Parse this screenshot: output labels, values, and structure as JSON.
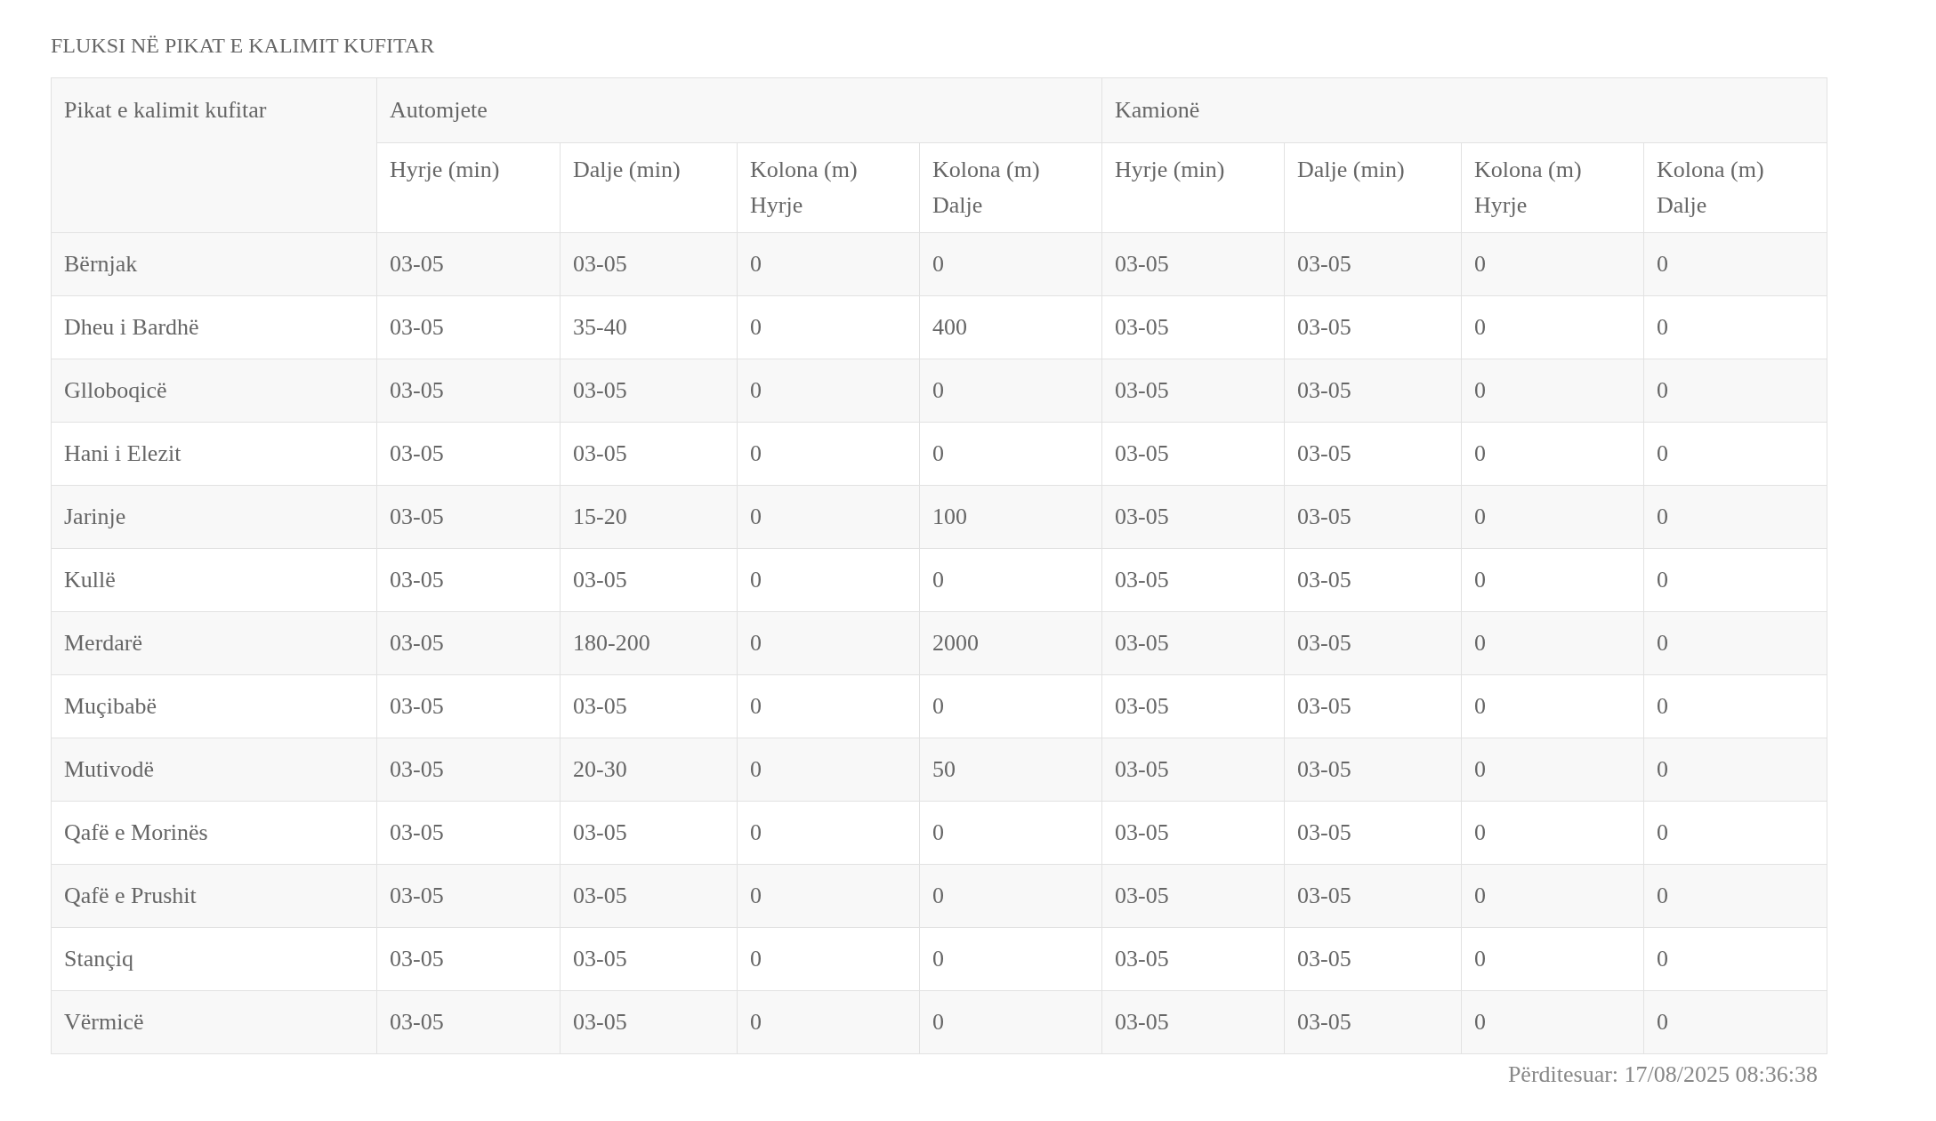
{
  "title": "FLUKSI NË PIKAT E KALIMIT KUFITAR",
  "table": {
    "first_column": "Pikat e kalimit kufitar",
    "groups": [
      {
        "label": "Automjete",
        "columns": [
          "Hyrje (min)",
          "Dalje (min)",
          "Kolona (m) Hyrje",
          "Kolona (m) Dalje"
        ]
      },
      {
        "label": "Kamionë",
        "columns": [
          "Hyrje (min)",
          "Dalje (min)",
          "Kolona (m) Hyrje",
          "Kolona (m) Dalje"
        ]
      }
    ],
    "rows": [
      {
        "name": "Bërnjak",
        "cells": [
          "03-05",
          "03-05",
          "0",
          "0",
          "03-05",
          "03-05",
          "0",
          "0"
        ]
      },
      {
        "name": "Dheu i Bardhë",
        "cells": [
          "03-05",
          "35-40",
          "0",
          "400",
          "03-05",
          "03-05",
          "0",
          "0"
        ]
      },
      {
        "name": "Glloboqicë",
        "cells": [
          "03-05",
          "03-05",
          "0",
          "0",
          "03-05",
          "03-05",
          "0",
          "0"
        ]
      },
      {
        "name": "Hani i Elezit",
        "cells": [
          "03-05",
          "03-05",
          "0",
          "0",
          "03-05",
          "03-05",
          "0",
          "0"
        ]
      },
      {
        "name": "Jarinje",
        "cells": [
          "03-05",
          "15-20",
          "0",
          "100",
          "03-05",
          "03-05",
          "0",
          "0"
        ]
      },
      {
        "name": "Kullë",
        "cells": [
          "03-05",
          "03-05",
          "0",
          "0",
          "03-05",
          "03-05",
          "0",
          "0"
        ]
      },
      {
        "name": "Merdarë",
        "cells": [
          "03-05",
          "180-200",
          "0",
          "2000",
          "03-05",
          "03-05",
          "0",
          "0"
        ]
      },
      {
        "name": "Muçibabë",
        "cells": [
          "03-05",
          "03-05",
          "0",
          "0",
          "03-05",
          "03-05",
          "0",
          "0"
        ]
      },
      {
        "name": "Mutivodë",
        "cells": [
          "03-05",
          "20-30",
          "0",
          "50",
          "03-05",
          "03-05",
          "0",
          "0"
        ]
      },
      {
        "name": "Qafë e Morinës",
        "cells": [
          "03-05",
          "03-05",
          "0",
          "0",
          "03-05",
          "03-05",
          "0",
          "0"
        ]
      },
      {
        "name": "Qafë e Prushit",
        "cells": [
          "03-05",
          "03-05",
          "0",
          "0",
          "03-05",
          "03-05",
          "0",
          "0"
        ]
      },
      {
        "name": "Stançiq",
        "cells": [
          "03-05",
          "03-05",
          "0",
          "0",
          "03-05",
          "03-05",
          "0",
          "0"
        ]
      },
      {
        "name": "Vërmicë",
        "cells": [
          "03-05",
          "03-05",
          "0",
          "0",
          "03-05",
          "03-05",
          "0",
          "0"
        ]
      }
    ]
  },
  "updated": "Përditesuar: 17/08/2025 08:36:38"
}
